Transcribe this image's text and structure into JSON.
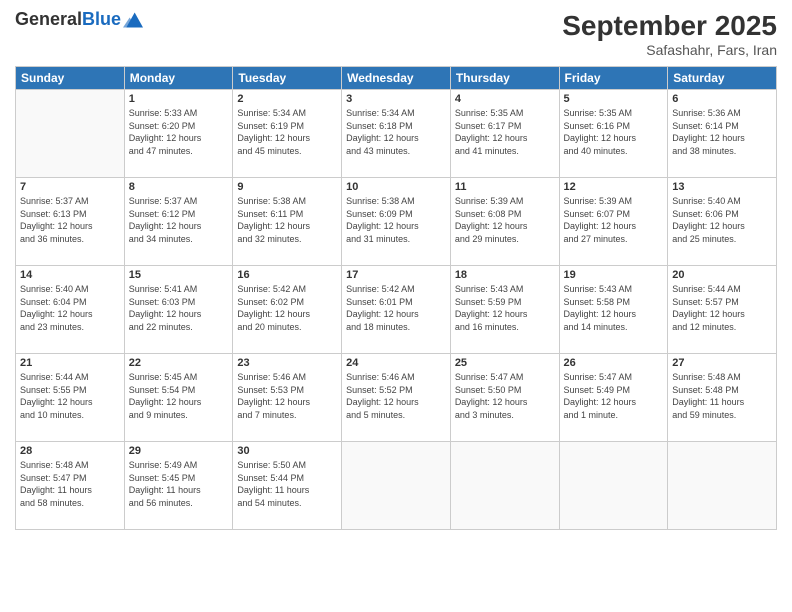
{
  "header": {
    "logo_line1": "General",
    "logo_line2": "Blue",
    "month_title": "September 2025",
    "subtitle": "Safashahr, Fars, Iran"
  },
  "weekdays": [
    "Sunday",
    "Monday",
    "Tuesday",
    "Wednesday",
    "Thursday",
    "Friday",
    "Saturday"
  ],
  "weeks": [
    [
      {
        "day": "",
        "info": ""
      },
      {
        "day": "1",
        "info": "Sunrise: 5:33 AM\nSunset: 6:20 PM\nDaylight: 12 hours\nand 47 minutes."
      },
      {
        "day": "2",
        "info": "Sunrise: 5:34 AM\nSunset: 6:19 PM\nDaylight: 12 hours\nand 45 minutes."
      },
      {
        "day": "3",
        "info": "Sunrise: 5:34 AM\nSunset: 6:18 PM\nDaylight: 12 hours\nand 43 minutes."
      },
      {
        "day": "4",
        "info": "Sunrise: 5:35 AM\nSunset: 6:17 PM\nDaylight: 12 hours\nand 41 minutes."
      },
      {
        "day": "5",
        "info": "Sunrise: 5:35 AM\nSunset: 6:16 PM\nDaylight: 12 hours\nand 40 minutes."
      },
      {
        "day": "6",
        "info": "Sunrise: 5:36 AM\nSunset: 6:14 PM\nDaylight: 12 hours\nand 38 minutes."
      }
    ],
    [
      {
        "day": "7",
        "info": "Sunrise: 5:37 AM\nSunset: 6:13 PM\nDaylight: 12 hours\nand 36 minutes."
      },
      {
        "day": "8",
        "info": "Sunrise: 5:37 AM\nSunset: 6:12 PM\nDaylight: 12 hours\nand 34 minutes."
      },
      {
        "day": "9",
        "info": "Sunrise: 5:38 AM\nSunset: 6:11 PM\nDaylight: 12 hours\nand 32 minutes."
      },
      {
        "day": "10",
        "info": "Sunrise: 5:38 AM\nSunset: 6:09 PM\nDaylight: 12 hours\nand 31 minutes."
      },
      {
        "day": "11",
        "info": "Sunrise: 5:39 AM\nSunset: 6:08 PM\nDaylight: 12 hours\nand 29 minutes."
      },
      {
        "day": "12",
        "info": "Sunrise: 5:39 AM\nSunset: 6:07 PM\nDaylight: 12 hours\nand 27 minutes."
      },
      {
        "day": "13",
        "info": "Sunrise: 5:40 AM\nSunset: 6:06 PM\nDaylight: 12 hours\nand 25 minutes."
      }
    ],
    [
      {
        "day": "14",
        "info": "Sunrise: 5:40 AM\nSunset: 6:04 PM\nDaylight: 12 hours\nand 23 minutes."
      },
      {
        "day": "15",
        "info": "Sunrise: 5:41 AM\nSunset: 6:03 PM\nDaylight: 12 hours\nand 22 minutes."
      },
      {
        "day": "16",
        "info": "Sunrise: 5:42 AM\nSunset: 6:02 PM\nDaylight: 12 hours\nand 20 minutes."
      },
      {
        "day": "17",
        "info": "Sunrise: 5:42 AM\nSunset: 6:01 PM\nDaylight: 12 hours\nand 18 minutes."
      },
      {
        "day": "18",
        "info": "Sunrise: 5:43 AM\nSunset: 5:59 PM\nDaylight: 12 hours\nand 16 minutes."
      },
      {
        "day": "19",
        "info": "Sunrise: 5:43 AM\nSunset: 5:58 PM\nDaylight: 12 hours\nand 14 minutes."
      },
      {
        "day": "20",
        "info": "Sunrise: 5:44 AM\nSunset: 5:57 PM\nDaylight: 12 hours\nand 12 minutes."
      }
    ],
    [
      {
        "day": "21",
        "info": "Sunrise: 5:44 AM\nSunset: 5:55 PM\nDaylight: 12 hours\nand 10 minutes."
      },
      {
        "day": "22",
        "info": "Sunrise: 5:45 AM\nSunset: 5:54 PM\nDaylight: 12 hours\nand 9 minutes."
      },
      {
        "day": "23",
        "info": "Sunrise: 5:46 AM\nSunset: 5:53 PM\nDaylight: 12 hours\nand 7 minutes."
      },
      {
        "day": "24",
        "info": "Sunrise: 5:46 AM\nSunset: 5:52 PM\nDaylight: 12 hours\nand 5 minutes."
      },
      {
        "day": "25",
        "info": "Sunrise: 5:47 AM\nSunset: 5:50 PM\nDaylight: 12 hours\nand 3 minutes."
      },
      {
        "day": "26",
        "info": "Sunrise: 5:47 AM\nSunset: 5:49 PM\nDaylight: 12 hours\nand 1 minute."
      },
      {
        "day": "27",
        "info": "Sunrise: 5:48 AM\nSunset: 5:48 PM\nDaylight: 11 hours\nand 59 minutes."
      }
    ],
    [
      {
        "day": "28",
        "info": "Sunrise: 5:48 AM\nSunset: 5:47 PM\nDaylight: 11 hours\nand 58 minutes."
      },
      {
        "day": "29",
        "info": "Sunrise: 5:49 AM\nSunset: 5:45 PM\nDaylight: 11 hours\nand 56 minutes."
      },
      {
        "day": "30",
        "info": "Sunrise: 5:50 AM\nSunset: 5:44 PM\nDaylight: 11 hours\nand 54 minutes."
      },
      {
        "day": "",
        "info": ""
      },
      {
        "day": "",
        "info": ""
      },
      {
        "day": "",
        "info": ""
      },
      {
        "day": "",
        "info": ""
      }
    ]
  ]
}
